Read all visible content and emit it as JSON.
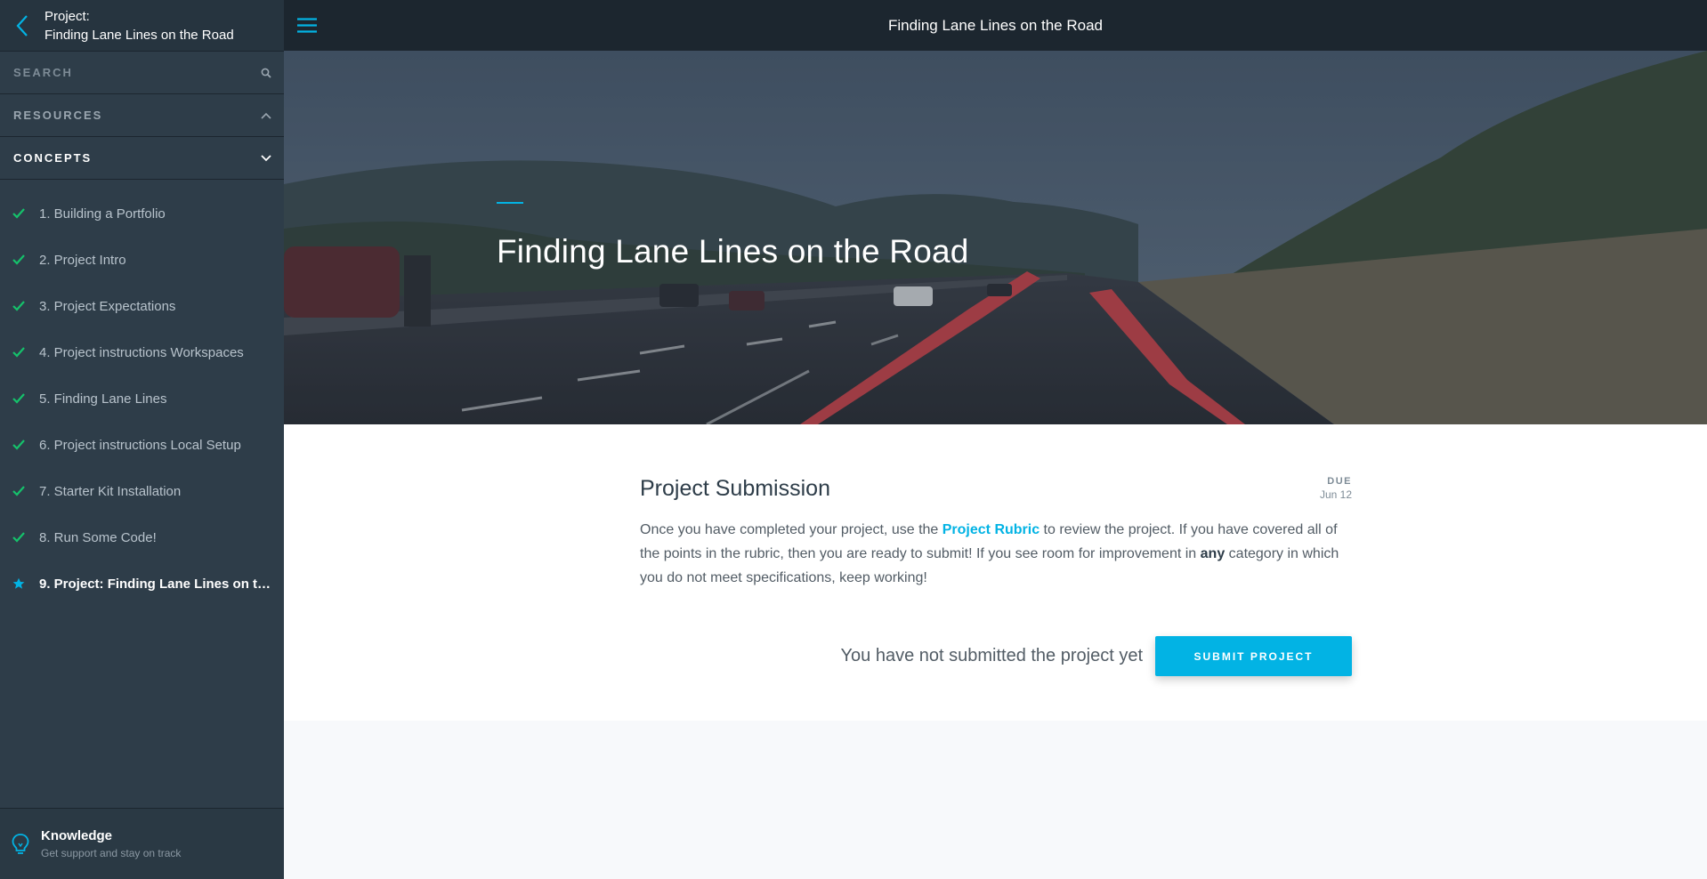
{
  "sidebar": {
    "project_prefix": "Project:",
    "project_title": "Finding Lane Lines on the Road",
    "search_label": "SEARCH",
    "resources_label": "RESOURCES",
    "concepts_label": "CONCEPTS",
    "concepts": [
      {
        "label": "1. Building a Portfolio",
        "status": "complete"
      },
      {
        "label": "2. Project Intro",
        "status": "complete"
      },
      {
        "label": "3. Project Expectations",
        "status": "complete"
      },
      {
        "label": "4. Project instructions Workspaces",
        "status": "complete"
      },
      {
        "label": "5. Finding Lane Lines",
        "status": "complete"
      },
      {
        "label": "6. Project instructions Local Setup",
        "status": "complete"
      },
      {
        "label": "7. Starter Kit Installation",
        "status": "complete"
      },
      {
        "label": "8. Run Some Code!",
        "status": "complete"
      },
      {
        "label": "9. Project: Finding Lane Lines on the ...",
        "status": "current"
      }
    ],
    "knowledge": {
      "title": "Knowledge",
      "subtitle": "Get support and stay on track"
    }
  },
  "topbar": {
    "title": "Finding Lane Lines on the Road"
  },
  "hero": {
    "title": "Finding Lane Lines on the Road"
  },
  "submission": {
    "title": "Project Submission",
    "due_label": "DUE",
    "due_date": "Jun 12",
    "text_before_link": "Once you have completed your project, use the ",
    "link_text": "Project Rubric",
    "text_middle": " to review the project. If you have covered all of the points in the rubric, then you are ready to submit! If you see room for improvement in ",
    "bold_text": "any",
    "text_after": " category in which you do not meet specifications, keep working!",
    "status_text": "You have not submitted the project yet",
    "submit_label": "SUBMIT PROJECT"
  },
  "colors": {
    "accent": "#02b3e4",
    "sidebar_bg": "#2e3d49",
    "topbar_bg": "#1c262f",
    "check": "#15c26b"
  }
}
